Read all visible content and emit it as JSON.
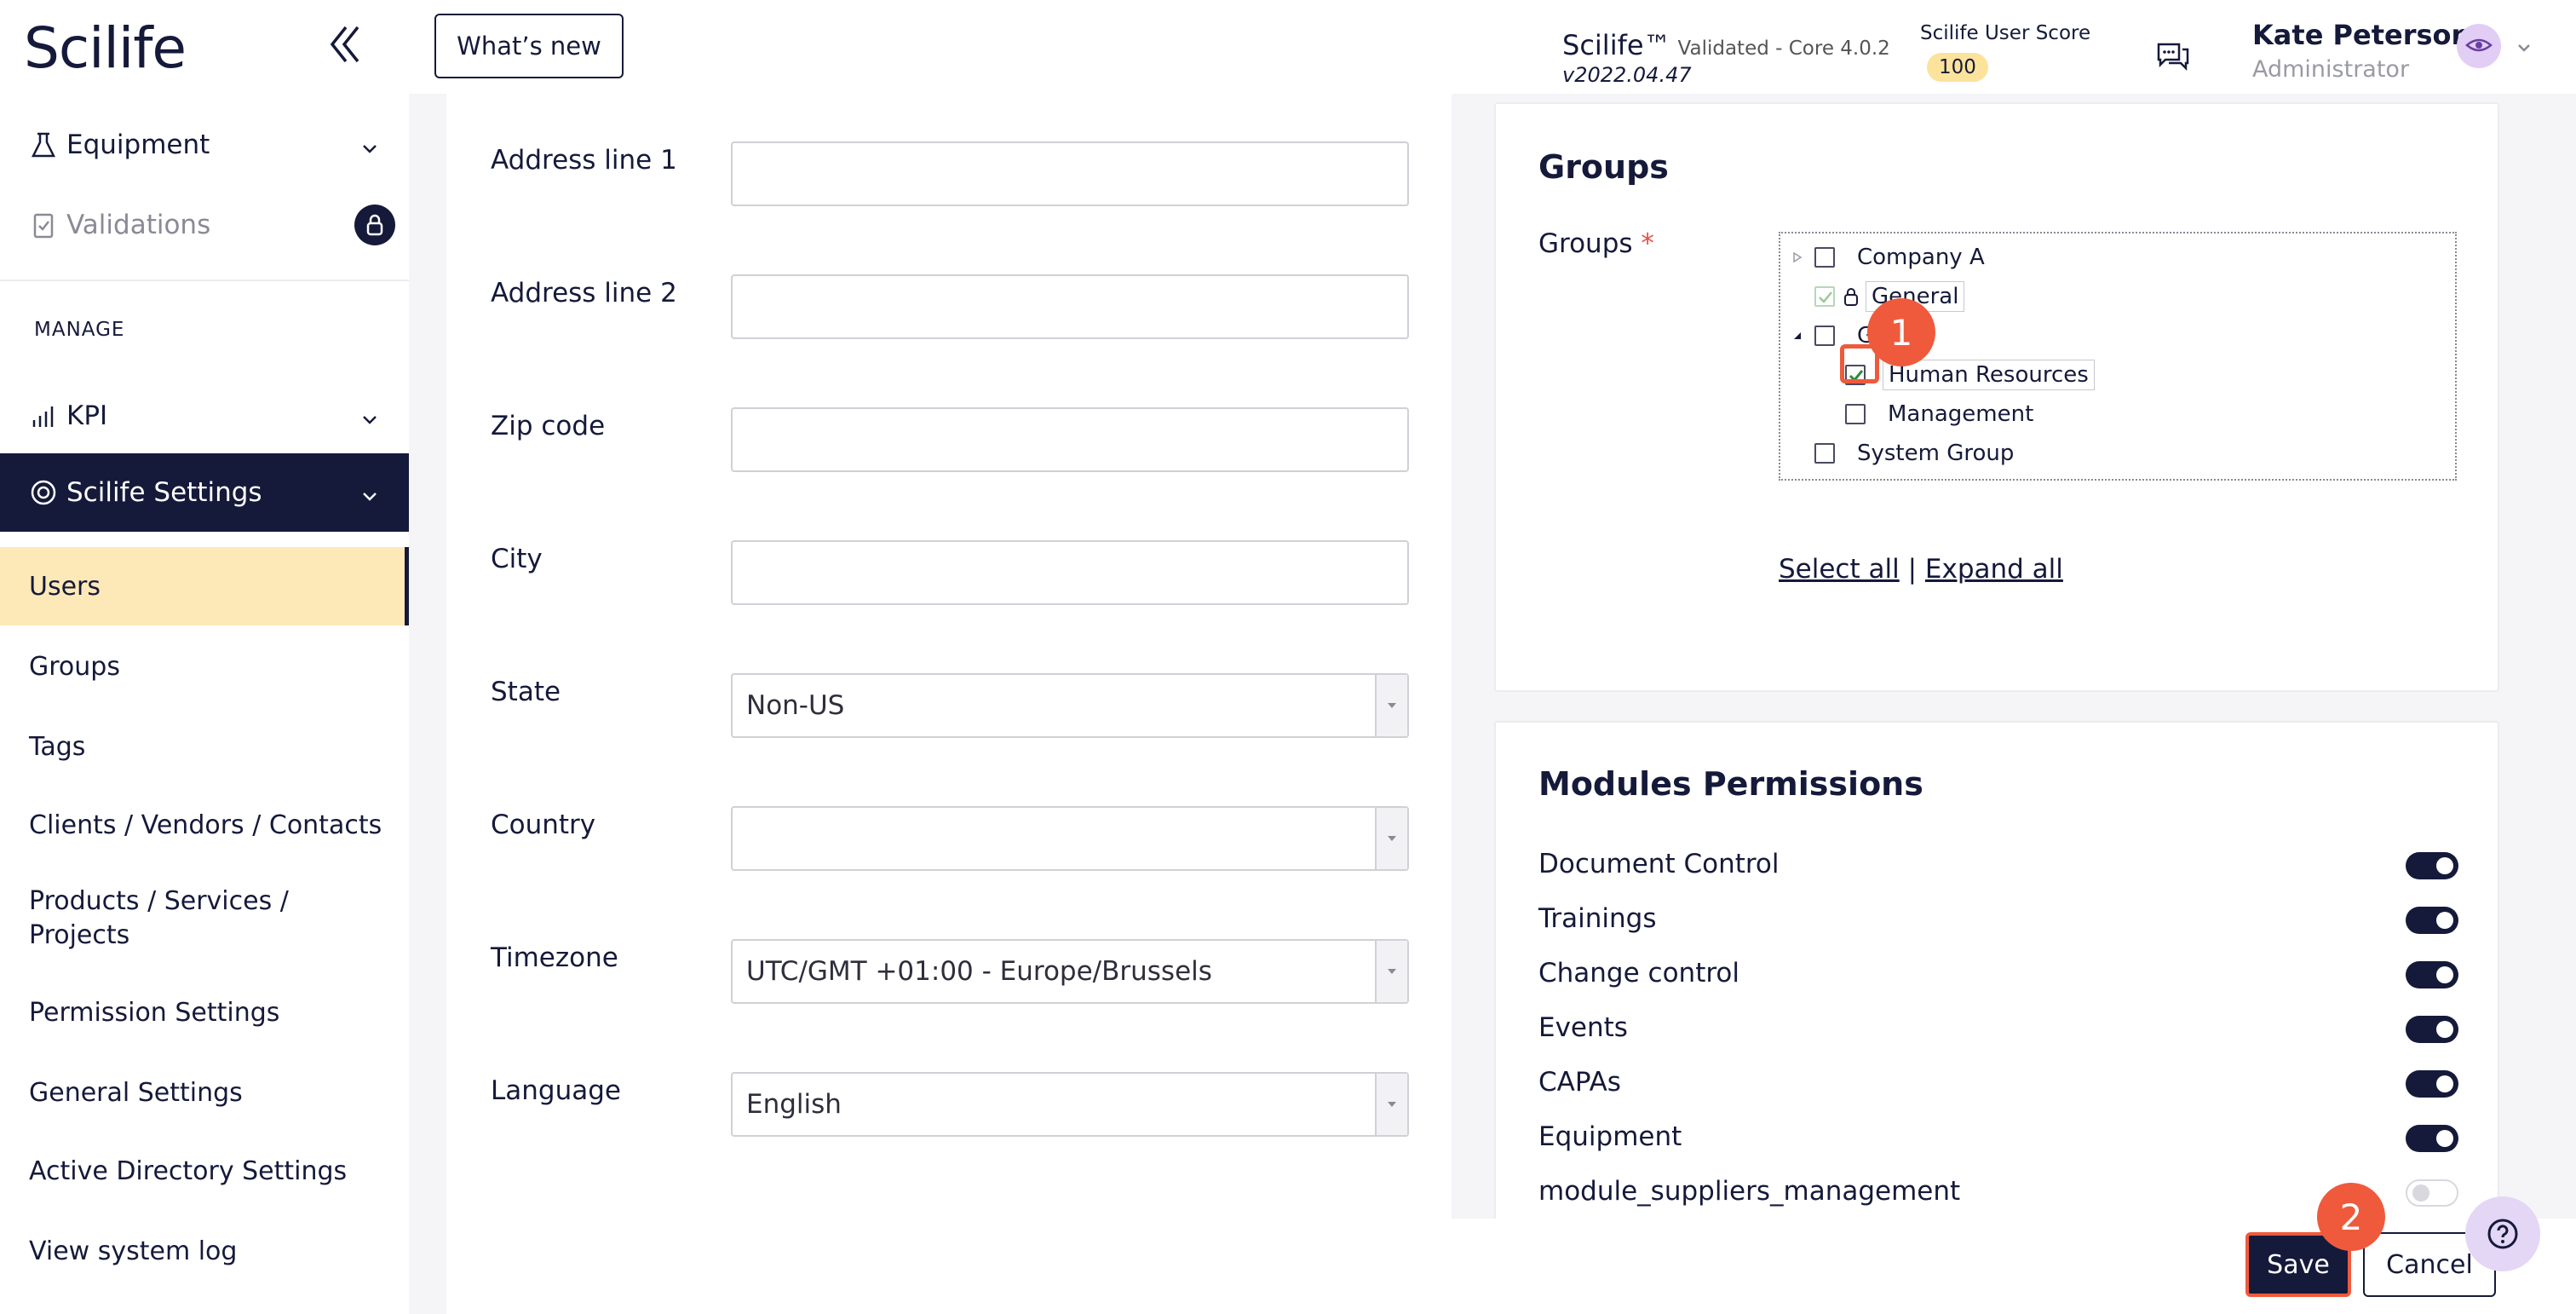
{
  "sidebar": {
    "logo": "Scilife",
    "items_top": [
      {
        "label": "Equipment"
      },
      {
        "label": "Validations"
      }
    ],
    "section_label": "MANAGE",
    "kpi": {
      "label": "KPI"
    },
    "settings": {
      "label": "Scilife Settings"
    },
    "sub_items": [
      {
        "label": "Users"
      },
      {
        "label": "Groups"
      },
      {
        "label": "Tags"
      },
      {
        "label": "Clients / Vendors / Contacts"
      },
      {
        "label": "Products / Services /"
      },
      {
        "label": "Permission Settings"
      },
      {
        "label": "General Settings"
      },
      {
        "label": "Active Directory Settings"
      },
      {
        "label": "View system log"
      }
    ],
    "products_line2": "Projects"
  },
  "header": {
    "whats_new": "What’s new",
    "app_name": "Scilife™",
    "validated": "Validated - Core 4.0.2",
    "version": "v2022.04.47",
    "score_label": "Scilife User Score",
    "score_value": "100",
    "user_name": "Kate Peterson",
    "user_role": "Administrator"
  },
  "form": {
    "address1": {
      "label": "Address line 1",
      "value": ""
    },
    "address2": {
      "label": "Address line 2",
      "value": ""
    },
    "zip": {
      "label": "Zip code",
      "value": ""
    },
    "city": {
      "label": "City",
      "value": ""
    },
    "state": {
      "label": "State",
      "value": "Non-US"
    },
    "country": {
      "label": "Country",
      "value": ""
    },
    "timezone": {
      "label": "Timezone",
      "value": "UTC/GMT +01:00 - Europe/Brussels"
    },
    "language": {
      "label": "Language",
      "value": "English"
    }
  },
  "groups_panel": {
    "title": "Groups",
    "label": "Groups",
    "required_mark": "*",
    "tree": [
      {
        "label": "Company A"
      },
      {
        "label": "General"
      },
      {
        "label": "Global"
      },
      {
        "label": "Human Resources"
      },
      {
        "label": "Management"
      },
      {
        "label": "System Group"
      }
    ],
    "select_all": "Select all",
    "separator": "|",
    "expand_all": "Expand all"
  },
  "permissions_panel": {
    "title": "Modules Permissions",
    "items": [
      {
        "label": "Document Control",
        "on": true
      },
      {
        "label": "Trainings",
        "on": true
      },
      {
        "label": "Change control",
        "on": true
      },
      {
        "label": "Events",
        "on": true
      },
      {
        "label": "CAPAs",
        "on": true
      },
      {
        "label": "Equipment",
        "on": true
      },
      {
        "label": "module_suppliers_management",
        "on": false
      }
    ]
  },
  "footer": {
    "save": "Save",
    "cancel": "Cancel"
  },
  "markers": {
    "step1": "1",
    "step2": "2"
  },
  "colors": {
    "navy": "#151a3a",
    "active_bg": "#fde9b8",
    "accent": "#ef5a3c",
    "score_badge": "#fbe39c"
  }
}
